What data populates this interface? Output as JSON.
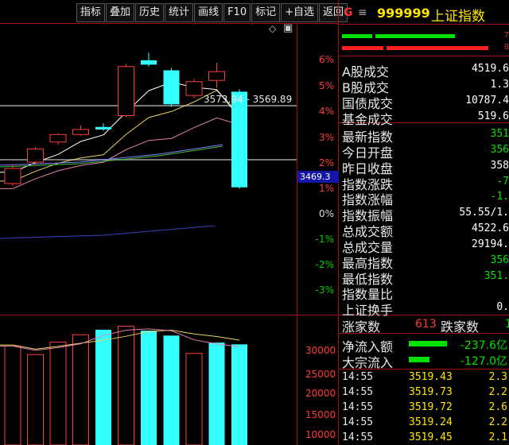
{
  "toolbar": [
    "指标",
    "叠加",
    "历史",
    "统计",
    "画线",
    "F10",
    "标记",
    "+自选",
    "返回"
  ],
  "header": {
    "logo": "G",
    "code": "999999",
    "name": "上证指数"
  },
  "edge_numbers": [
    "7",
    "8"
  ],
  "icons": {
    "diamond": "◇",
    "window": "▣",
    "menu": "≡"
  },
  "price_annotation": "3573.94 - 3569.89",
  "current_price": "3469.3",
  "pct_labels": [
    {
      "text": "6%",
      "color": "red"
    },
    {
      "text": "5%",
      "color": "red"
    },
    {
      "text": "4%",
      "color": "red"
    },
    {
      "text": "3%",
      "color": "red"
    },
    {
      "text": "2%",
      "color": "red"
    },
    {
      "text": "1%",
      "color": "red"
    },
    {
      "text": "0%",
      "color": "white"
    },
    {
      "text": "-1%",
      "color": "green"
    },
    {
      "text": "-2%",
      "color": "green"
    },
    {
      "text": "-3%",
      "color": "green"
    }
  ],
  "vol_labels": [
    "30000",
    "25000",
    "20000",
    "15000",
    "10000"
  ],
  "stats": [
    {
      "label": "A股成交",
      "value": "4519.6",
      "color": "white"
    },
    {
      "label": "B股成交",
      "value": "1.3",
      "color": "white"
    },
    {
      "label": "国债成交",
      "value": "10787.4",
      "color": "white"
    },
    {
      "label": "基金成交",
      "value": "519.6",
      "color": "white"
    },
    {
      "label": "最新指数",
      "value": "351",
      "color": "green"
    },
    {
      "label": "今日开盘",
      "value": "356",
      "color": "green"
    },
    {
      "label": "昨日收盘",
      "value": "358",
      "color": "white"
    },
    {
      "label": "指数涨跌",
      "value": "-7",
      "color": "green"
    },
    {
      "label": "指数涨幅",
      "value": "-1.",
      "color": "green"
    },
    {
      "label": "指数振幅",
      "value": "55.55/1.",
      "color": "white"
    },
    {
      "label": "总成交额",
      "value": "4522.6",
      "color": "white"
    },
    {
      "label": "总成交量",
      "value": "29194.",
      "color": "white"
    },
    {
      "label": "最高指数",
      "value": "356",
      "color": "green"
    },
    {
      "label": "最低指数",
      "value": "351.",
      "color": "green"
    },
    {
      "label": "指数量比",
      "value": "",
      "color": "white"
    },
    {
      "label": "上证换手",
      "value": "0.",
      "color": "white"
    }
  ],
  "updown": {
    "up_label": "涨家数",
    "up_count": "613",
    "down_label": "跌家数",
    "down_count": "1"
  },
  "flows": [
    {
      "label": "净流入额",
      "value": "-237.6亿",
      "bar_width": 48
    },
    {
      "label": "大宗流入",
      "value": "-127.0亿",
      "bar_width": 26
    }
  ],
  "trades": [
    {
      "time": "14:55",
      "price": "3519.43",
      "vol": "2.3"
    },
    {
      "time": "14:55",
      "price": "3519.73",
      "vol": "2.2"
    },
    {
      "time": "14:55",
      "price": "3519.72",
      "vol": "2.6"
    },
    {
      "time": "14:55",
      "price": "3519.24",
      "vol": "2.2"
    },
    {
      "time": "14:55",
      "price": "3519.45",
      "vol": "2.1"
    }
  ],
  "colors": {
    "up": "#ff3b3b",
    "down": "#33ffff",
    "ma_white": "#ffffff",
    "ma_yellow": "#e8d060",
    "ma_pink": "#e080b0",
    "ma_green": "#40c040",
    "ma_blue": "#4040c0",
    "grid": "#a01010"
  },
  "candles": [
    {
      "o": 3404,
      "c": 3428,
      "h": 3434,
      "l": 3400
    },
    {
      "o": 3438,
      "c": 3459,
      "h": 3462,
      "l": 3434
    },
    {
      "o": 3470,
      "c": 3482,
      "h": 3484,
      "l": 3466
    },
    {
      "o": 3482,
      "c": 3490,
      "h": 3496,
      "l": 3480
    },
    {
      "o": 3494,
      "c": 3490,
      "h": 3500,
      "l": 3488
    },
    {
      "o": 3512,
      "c": 3590,
      "h": 3594,
      "l": 3510
    },
    {
      "o": 3600,
      "c": 3593,
      "h": 3612,
      "l": 3590
    },
    {
      "o": 3584,
      "c": 3530,
      "h": 3588,
      "l": 3526
    },
    {
      "o": 3544,
      "c": 3566,
      "h": 3570,
      "l": 3540
    },
    {
      "o": 3568,
      "c": 3582,
      "h": 3596,
      "l": 3556
    },
    {
      "o": 3550,
      "c": 3398,
      "h": 3554,
      "l": 3396
    }
  ],
  "volumes": [
    {
      "v": 33800,
      "dir": "up"
    },
    {
      "v": 30900,
      "dir": "up"
    },
    {
      "v": 35200,
      "dir": "up"
    },
    {
      "v": 37700,
      "dir": "up"
    },
    {
      "v": 39400,
      "dir": "down"
    },
    {
      "v": 40600,
      "dir": "up"
    },
    {
      "v": 39100,
      "dir": "down"
    },
    {
      "v": 37400,
      "dir": "down"
    },
    {
      "v": 31300,
      "dir": "up"
    },
    {
      "v": 35000,
      "dir": "down"
    },
    {
      "v": 34400,
      "dir": "down"
    }
  ]
}
